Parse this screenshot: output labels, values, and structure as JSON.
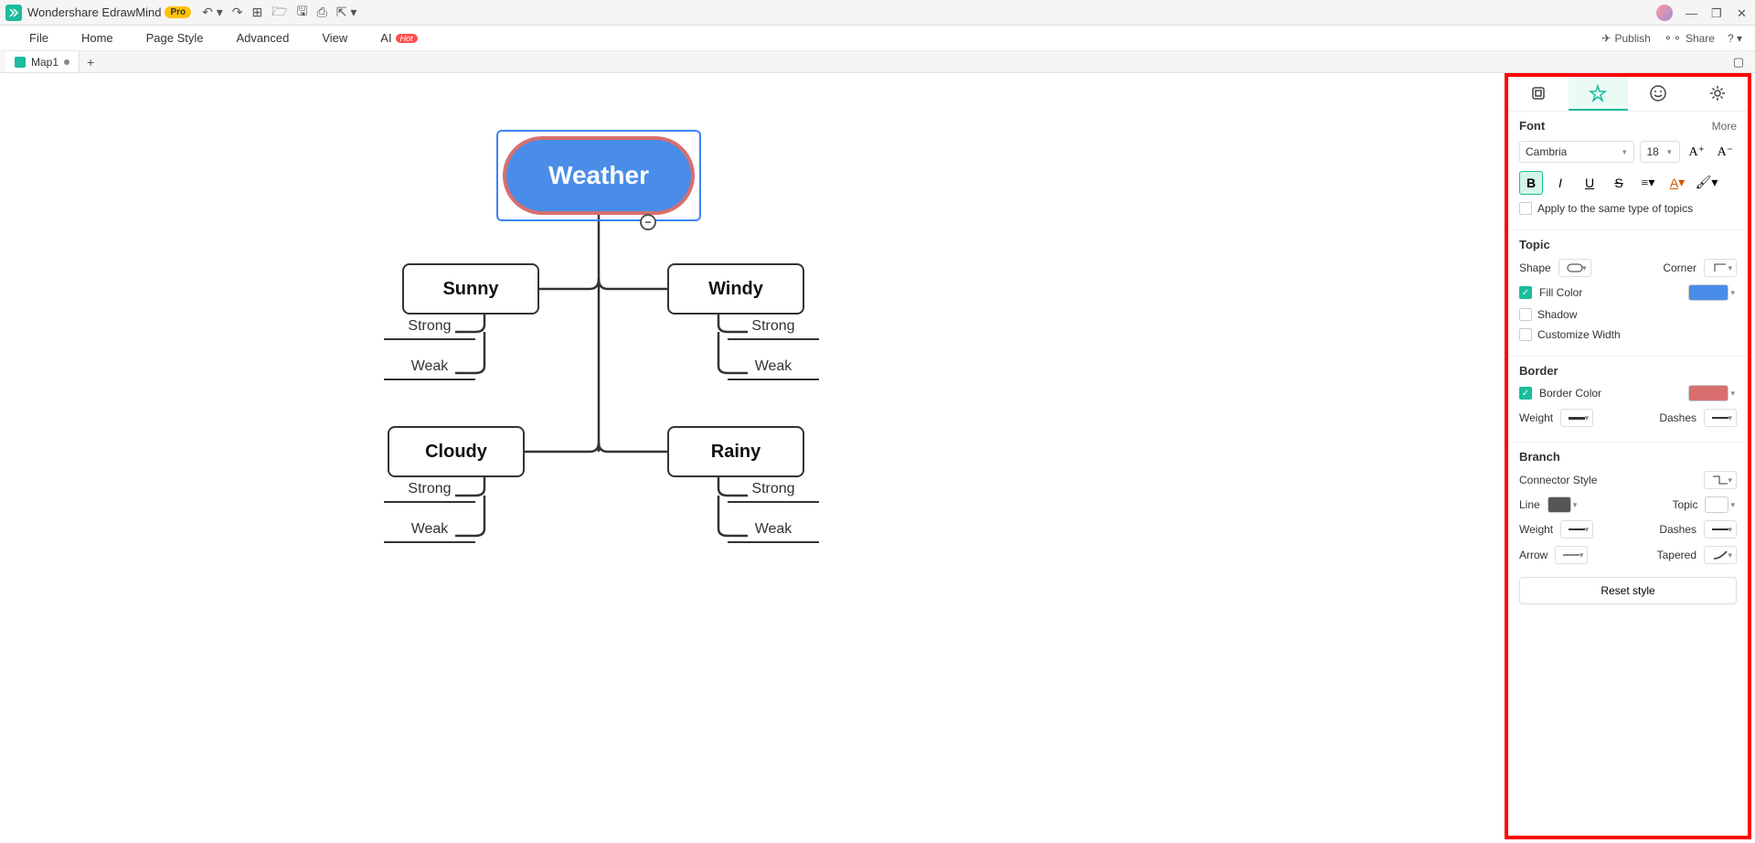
{
  "app": {
    "title": "Wondershare EdrawMind",
    "badge": "Pro"
  },
  "menubar": {
    "file": "File",
    "home": "Home",
    "page_style": "Page Style",
    "advanced": "Advanced",
    "view": "View",
    "ai": "AI",
    "ai_badge": "Hot"
  },
  "menubar_right": {
    "publish": "Publish",
    "share": "Share"
  },
  "tabs": {
    "tab1": "Map1"
  },
  "mindmap": {
    "central": "Weather",
    "sunny": "Sunny",
    "windy": "Windy",
    "cloudy": "Cloudy",
    "rainy": "Rainy",
    "strong": "Strong",
    "weak": "Weak"
  },
  "panel": {
    "font": {
      "title": "Font",
      "more": "More",
      "family": "Cambria",
      "size": "18",
      "apply_same": "Apply to the same type of topics"
    },
    "topic": {
      "title": "Topic",
      "shape": "Shape",
      "corner": "Corner",
      "fill_color": "Fill Color",
      "shadow": "Shadow",
      "customize_width": "Customize Width"
    },
    "border": {
      "title": "Border",
      "border_color": "Border Color",
      "weight": "Weight",
      "dashes": "Dashes"
    },
    "branch": {
      "title": "Branch",
      "connector_style": "Connector Style",
      "line": "Line",
      "topic_label": "Topic",
      "weight": "Weight",
      "dashes": "Dashes",
      "arrow": "Arrow",
      "tapered": "Tapered"
    },
    "reset": "Reset style"
  }
}
